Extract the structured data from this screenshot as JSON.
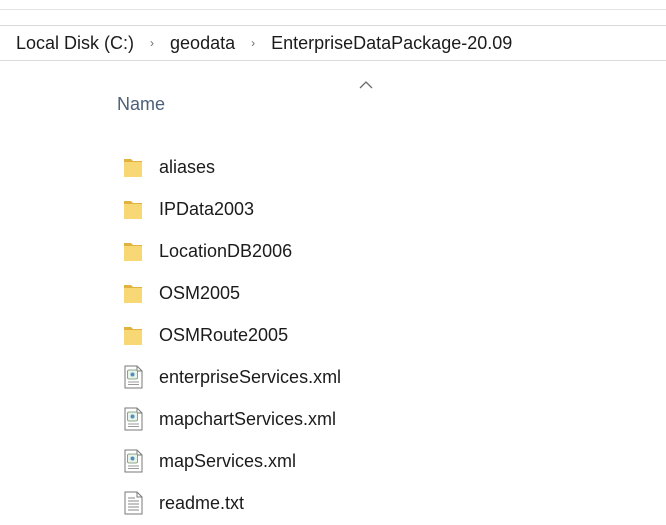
{
  "breadcrumb": {
    "items": [
      {
        "label": "Local Disk (C:)"
      },
      {
        "label": "geodata"
      },
      {
        "label": "EnterpriseDataPackage-20.09"
      }
    ],
    "separator": "›"
  },
  "column_header": {
    "name_label": "Name",
    "sort_indicator": "ascending"
  },
  "files": [
    {
      "name": "aliases",
      "type": "folder",
      "icon": "folder-icon"
    },
    {
      "name": "IPData2003",
      "type": "folder",
      "icon": "folder-icon"
    },
    {
      "name": "LocationDB2006",
      "type": "folder",
      "icon": "folder-icon"
    },
    {
      "name": "OSM2005",
      "type": "folder",
      "icon": "folder-icon"
    },
    {
      "name": "OSMRoute2005",
      "type": "folder",
      "icon": "folder-icon"
    },
    {
      "name": "enterpriseServices.xml",
      "type": "xml",
      "icon": "xml-file-icon"
    },
    {
      "name": "mapchartServices.xml",
      "type": "xml",
      "icon": "xml-file-icon"
    },
    {
      "name": "mapServices.xml",
      "type": "xml",
      "icon": "xml-file-icon"
    },
    {
      "name": "readme.txt",
      "type": "txt",
      "icon": "text-file-icon"
    }
  ],
  "colors": {
    "folder": "#f8d775",
    "folder_dark": "#e0b341",
    "header_text": "#4c607a",
    "text": "#1b1b1b",
    "border": "#d9d9d9"
  }
}
